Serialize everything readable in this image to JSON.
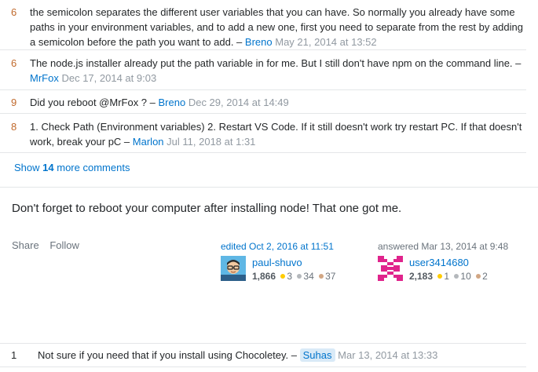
{
  "comments": [
    {
      "score": "6",
      "text": "the semicolon separates the different user variables that you can have. So normally you already have some paths in your environment variables, and to add a new one, first you need to separate from the rest by adding a semicolon before the path you want to add. –",
      "user": "Breno",
      "date": "May 21, 2014 at 13:52"
    },
    {
      "score": "6",
      "text": "The node.js installer already put the path variable in for me. But I still don't have npm on the command line. –",
      "user": "MrFox",
      "date": "Dec 17, 2014 at 9:03"
    },
    {
      "score": "9",
      "text": "Did you reboot @MrFox ? –",
      "user": "Breno",
      "date": "Dec 29, 2014 at 14:49"
    },
    {
      "score": "8",
      "text": "1. Check Path (Environment variables) 2. Restart VS Code. If it still doesn't work try restart PC. If that doesn't work, break your pC –",
      "user": "Marlon",
      "date": "Jul 11, 2018 at 1:31"
    }
  ],
  "show_more": {
    "prefix": "Show",
    "count": "14",
    "suffix": "more comments"
  },
  "answer": {
    "body": "Don't forget to reboot your computer after installing node! That one got me.",
    "menu": {
      "share": "Share",
      "follow": "Follow"
    },
    "editor": {
      "action": "edited",
      "date": "Oct 2, 2016 at 11:51",
      "name": "paul-shuvo",
      "reputation": "1,866",
      "gold": "3",
      "silver": "34",
      "bronze": "37"
    },
    "author": {
      "action": "answered",
      "date": "Mar 13, 2014 at 9:48",
      "name": "user3414680",
      "reputation": "2,183",
      "gold": "1",
      "silver": "10",
      "bronze": "2"
    }
  },
  "answer_comments": [
    {
      "score": "1",
      "text": "Not sure if you need that if you install using Chocoletey. –",
      "user": "Suhas",
      "date": "Mar 13, 2014 at 13:33"
    }
  ]
}
